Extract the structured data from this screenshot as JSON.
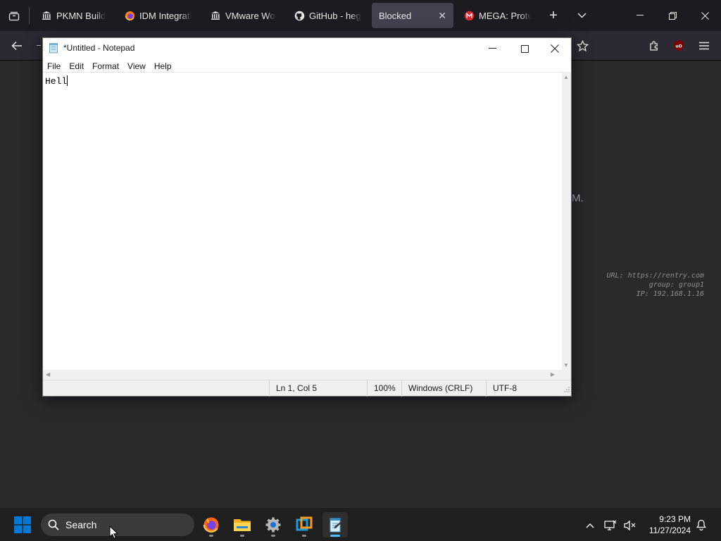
{
  "browser": {
    "tabs": [
      {
        "label": "PKMN Build M",
        "icon": "museum-icon"
      },
      {
        "label": "IDM Integratio",
        "icon": "firefox-icon"
      },
      {
        "label": "VMware Work",
        "icon": "museum-icon"
      },
      {
        "label": "GitHub - hegc",
        "icon": "github-icon"
      },
      {
        "label": "Blocked",
        "icon": "none",
        "active": true
      },
      {
        "label": "MEGA: Protec",
        "icon": "mega-icon"
      }
    ],
    "close_glyph": "✕",
    "new_tab_glyph": "+"
  },
  "page": {
    "partial_text": "M.",
    "info_lines": [
      "URL: https://rentry.com",
      "group: group1",
      "IP: 192.168.1.16"
    ]
  },
  "notepad": {
    "title": "*Untitled - Notepad",
    "menu": [
      "File",
      "Edit",
      "Format",
      "View",
      "Help"
    ],
    "content": "Hell",
    "status": {
      "position": "Ln 1, Col 5",
      "zoom": "100%",
      "line_endings": "Windows (CRLF)",
      "encoding": "UTF-8"
    }
  },
  "taskbar": {
    "search_label": "Search",
    "time": "9:23 PM",
    "date": "11/27/2024",
    "apps": [
      "firefox-icon",
      "file-explorer-icon",
      "settings-icon",
      "vmware-icon",
      "notepad-icon"
    ]
  },
  "colors": {
    "accent": "#4cc2ff",
    "windows_blue": "#0078d4",
    "active_tab": "#42414d"
  }
}
